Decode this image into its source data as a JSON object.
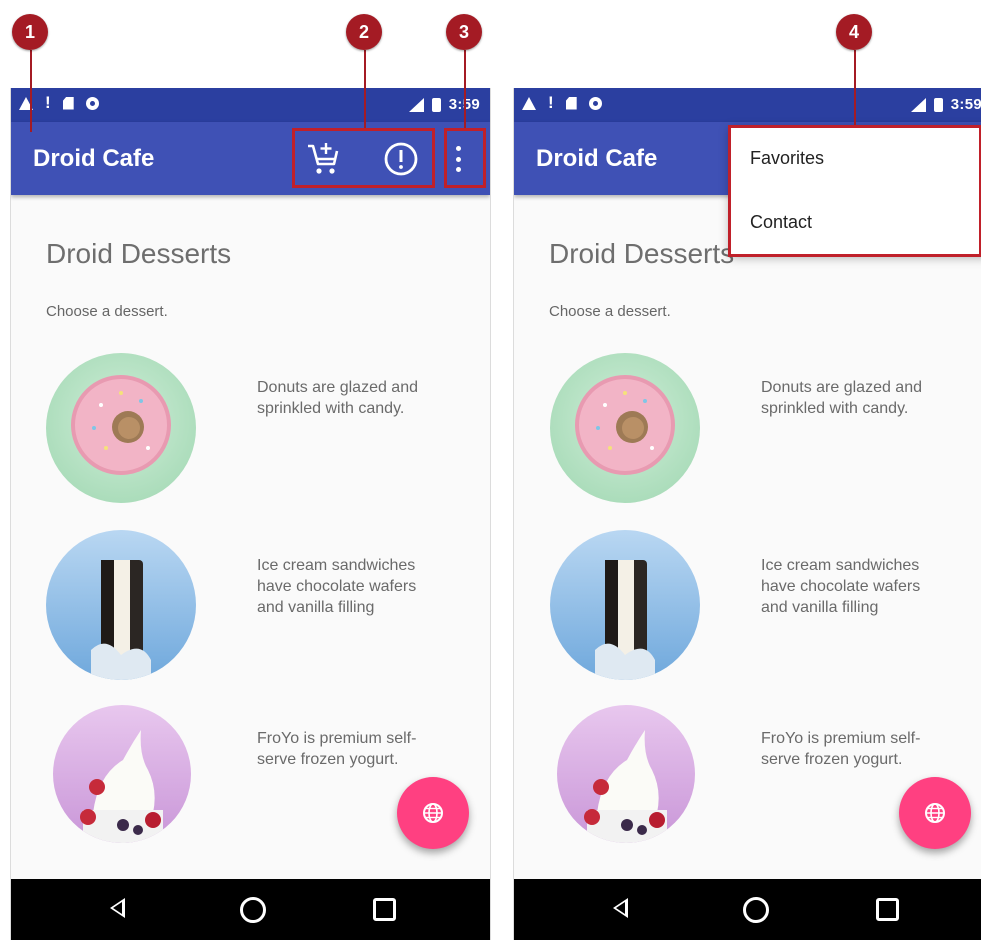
{
  "status_bar": {
    "time": "3:59"
  },
  "app_bar": {
    "title": "Droid Cafe"
  },
  "content": {
    "heading": "Droid Desserts",
    "subtext": "Choose a dessert.",
    "desserts": [
      {
        "name": "donut",
        "description": "Donuts are glazed and sprinkled with candy."
      },
      {
        "name": "ice-cream-sandwich",
        "description": "Ice cream sandwiches have chocolate wafers and vanilla filling"
      },
      {
        "name": "froyo",
        "description": "FroYo is premium self-serve frozen yogurt."
      }
    ]
  },
  "overflow_menu": {
    "items": [
      "Favorites",
      "Contact"
    ]
  },
  "callouts": [
    "1",
    "2",
    "3",
    "4"
  ],
  "icons": {
    "cart": "cart-add-icon",
    "info": "info-icon",
    "overflow": "overflow-menu-icon",
    "fab": "globe-icon",
    "nav_back": "nav-back-icon",
    "nav_home": "nav-home-icon",
    "nav_recent": "nav-recent-icon"
  },
  "colors": {
    "status_bar": "#2b3fa0",
    "app_bar": "#3f51b5",
    "fab": "#ff4081",
    "callout": "#a41b24"
  }
}
